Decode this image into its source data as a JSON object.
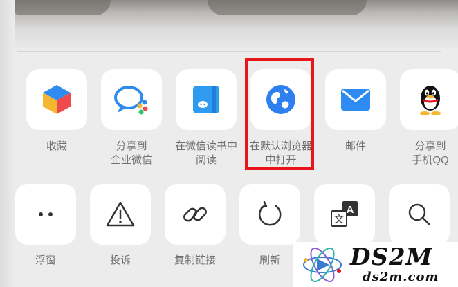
{
  "share_row": [
    {
      "label": "收藏",
      "icon": "cube-icon"
    },
    {
      "label": "分享到\n企业微信",
      "icon": "wecom-icon"
    },
    {
      "label": "在微信读书中\n阅读",
      "icon": "weread-icon"
    },
    {
      "label": "在默认浏览器\n中打开",
      "icon": "globe-icon"
    },
    {
      "label": "邮件",
      "icon": "mail-icon"
    },
    {
      "label": "分享到\n手机QQ",
      "icon": "qq-penguin-icon"
    }
  ],
  "action_row": [
    {
      "label": "浮窗",
      "icon": "float-dots-icon"
    },
    {
      "label": "投诉",
      "icon": "warning-icon"
    },
    {
      "label": "复制链接",
      "icon": "link-icon"
    },
    {
      "label": "刷新",
      "icon": "refresh-icon"
    },
    {
      "label": "",
      "icon": "translate-icon"
    },
    {
      "label": "",
      "icon": "search-icon"
    }
  ],
  "highlight_color": "#e8151b",
  "watermark": {
    "title": "DS2M",
    "subtitle": "ds2m.com"
  }
}
